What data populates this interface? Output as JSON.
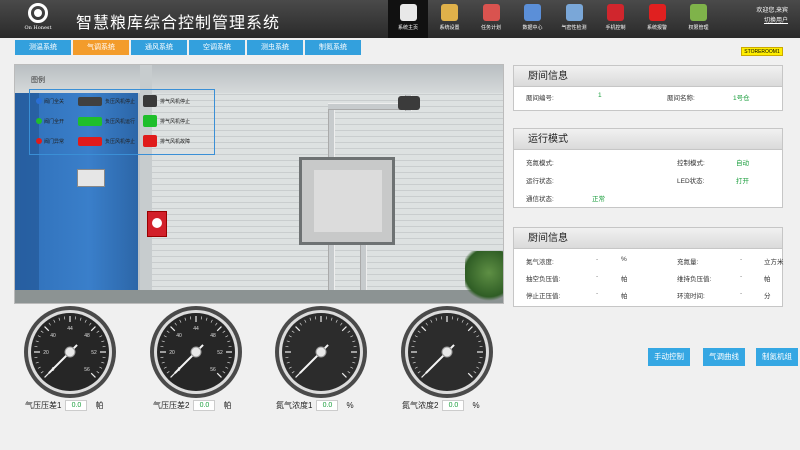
{
  "header": {
    "logo_text": "On Honest",
    "title": "智慧粮库综合控制管理系统",
    "welcome": "欢迎您,来宾",
    "switch_user": "切换用户",
    "nav": [
      {
        "label": "系统主页",
        "icon": "home-icon",
        "color": "#e8e8e8",
        "active": true
      },
      {
        "label": "系统设置",
        "icon": "tools-icon",
        "color": "#e0b14a",
        "active": false
      },
      {
        "label": "任务计划",
        "icon": "clipboard-icon",
        "color": "#d9534f",
        "active": false
      },
      {
        "label": "数据中心",
        "icon": "database-icon",
        "color": "#5b8fd8",
        "active": false
      },
      {
        "label": "气密性检测",
        "icon": "inspect-icon",
        "color": "#7aa7d8",
        "active": false
      },
      {
        "label": "手机控制",
        "icon": "mail-icon",
        "color": "#d0262d",
        "active": false
      },
      {
        "label": "系统报警",
        "icon": "alarm-icon",
        "color": "#e02020",
        "active": false
      },
      {
        "label": "权限管理",
        "icon": "users-icon",
        "color": "#7fb34a",
        "active": false
      }
    ]
  },
  "tabs": [
    {
      "label": "测温系统",
      "active": false
    },
    {
      "label": "气调系统",
      "active": true
    },
    {
      "label": "通风系统",
      "active": false
    },
    {
      "label": "空调系统",
      "active": false
    },
    {
      "label": "测虫系统",
      "active": false
    },
    {
      "label": "制氮系统",
      "active": false
    }
  ],
  "room_badge": "STOREROOM1",
  "legend": {
    "title": "图例",
    "rows": [
      {
        "dot": "#2a6fd6",
        "valve": "阀门全关",
        "valve_color": "#404040",
        "fan1": "负压风机停止",
        "fan1_color": "#3a3a3a",
        "fan2": "排气风机停止",
        "fan2_color": "#3a3a3a"
      },
      {
        "dot": "#1fbf2b",
        "valve": "阀门全开",
        "valve_color": "#1fbf2b",
        "fan1": "负压风机运行",
        "fan1_color": "#1fbf2b",
        "fan2": "排气风机停止",
        "fan2_color": "#1fbf2b"
      },
      {
        "dot": "#e01b1b",
        "valve": "阀门异常",
        "valve_color": "#e01b1b",
        "fan1": "负压风机停止",
        "fan1_color": "#e01b1b",
        "fan2": "排气风机故障",
        "fan2_color": "#e01b1b"
      }
    ]
  },
  "room_info": {
    "title": "厨间信息",
    "id_label": "厫间编号:",
    "id_value": "1",
    "name_label": "厫间名称:",
    "name_value": "1号仓"
  },
  "run_mode": {
    "title": "运行模式",
    "rows": [
      {
        "label": "充氮模式:",
        "value": "",
        "label2": "控制模式:",
        "value2": "自动"
      },
      {
        "label": "运行状态:",
        "value": "",
        "label2": "LED状态:",
        "value2": "打开"
      },
      {
        "label": "通信状态:",
        "value": "正常",
        "label2": "",
        "value2": ""
      }
    ]
  },
  "room_detail": {
    "title": "厨间信息",
    "rows": [
      {
        "label": "氮气浓度:",
        "dash": "-",
        "unit": "%",
        "label2": "充氮量:",
        "dash2": "-",
        "unit2": "立方米"
      },
      {
        "label": "抽空负压值:",
        "dash": "-",
        "unit": "帕",
        "label2": "维持负压值:",
        "dash2": "-",
        "unit2": "帕"
      },
      {
        "label": "停止正压值:",
        "dash": "-",
        "unit": "帕",
        "label2": "环流时间:",
        "dash2": "-",
        "unit2": "分"
      }
    ]
  },
  "gauges": [
    {
      "label": "气压压差1",
      "value": "0.0",
      "unit": "帕",
      "reading": 0,
      "ticks": [
        "0",
        "20",
        "40",
        "44",
        "48",
        "52",
        "56"
      ],
      "style": "dark"
    },
    {
      "label": "气压压差2",
      "value": "0.0",
      "unit": "帕",
      "reading": 0,
      "ticks": [
        "0",
        "20",
        "40",
        "44",
        "48",
        "52",
        "56"
      ],
      "style": "dark"
    },
    {
      "label": "氮气浓度1",
      "value": "0.0",
      "unit": "%",
      "reading": 0,
      "ticks": [],
      "style": "light"
    },
    {
      "label": "氮气浓度2",
      "value": "0.0",
      "unit": "%",
      "reading": 0,
      "ticks": [],
      "style": "light"
    }
  ],
  "actions": [
    "手动控制",
    "气调曲线",
    "制氮机组"
  ]
}
